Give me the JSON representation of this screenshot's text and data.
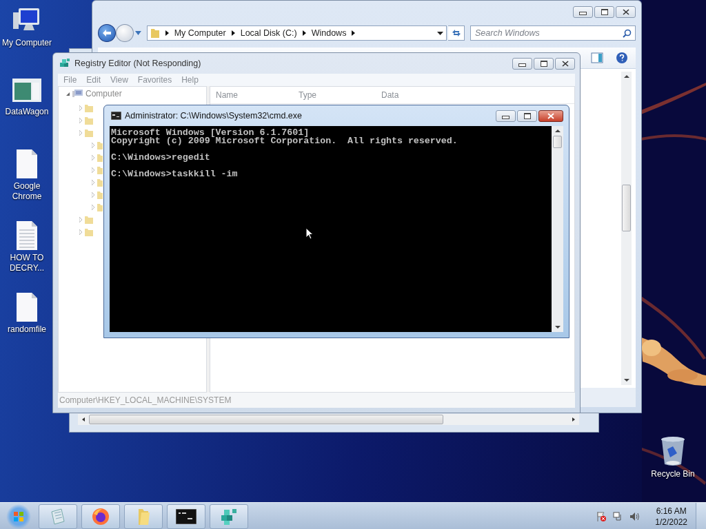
{
  "desktop_icons": [
    {
      "label": "My Computer",
      "kind": "computer"
    },
    {
      "label": "DataWagon",
      "kind": "app"
    },
    {
      "label": "Google Chrome",
      "kind": "file"
    },
    {
      "label": "HOW TO DECRY...",
      "kind": "textfile"
    },
    {
      "label": "randomfile",
      "kind": "file"
    }
  ],
  "recycle_bin": {
    "label": "Recycle Bin"
  },
  "explorer": {
    "breadcrumb": [
      "My Computer",
      "Local Disk (C:)",
      "Windows"
    ],
    "search": {
      "placeholder": "Search Windows"
    }
  },
  "regedit": {
    "title": "Registry Editor (Not Responding)",
    "menu": [
      "File",
      "Edit",
      "View",
      "Favorites",
      "Help"
    ],
    "tree": {
      "label": "Computer",
      "expanded": true
    },
    "columns": [
      "Name",
      "Type",
      "Data"
    ],
    "status": "Computer\\HKEY_LOCAL_MACHINE\\SYSTEM"
  },
  "cmd": {
    "title": "Administrator: C:\\Windows\\System32\\cmd.exe",
    "blocks": [
      [
        "Microsoft Windows [Version 6.1.7601]",
        "Copyright (c) 2009 Microsoft Corporation.  All rights reserved."
      ],
      [
        "C:\\Windows>regedit"
      ],
      [
        "C:\\Windows>taskkill -im"
      ]
    ]
  },
  "taskbar": {
    "buttons": [
      {
        "kind": "notepad"
      },
      {
        "kind": "firefox"
      },
      {
        "kind": "folder"
      },
      {
        "kind": "console"
      },
      {
        "kind": "registry"
      }
    ],
    "clock": {
      "time": "6:16 AM",
      "date": "1/2/2022"
    }
  }
}
